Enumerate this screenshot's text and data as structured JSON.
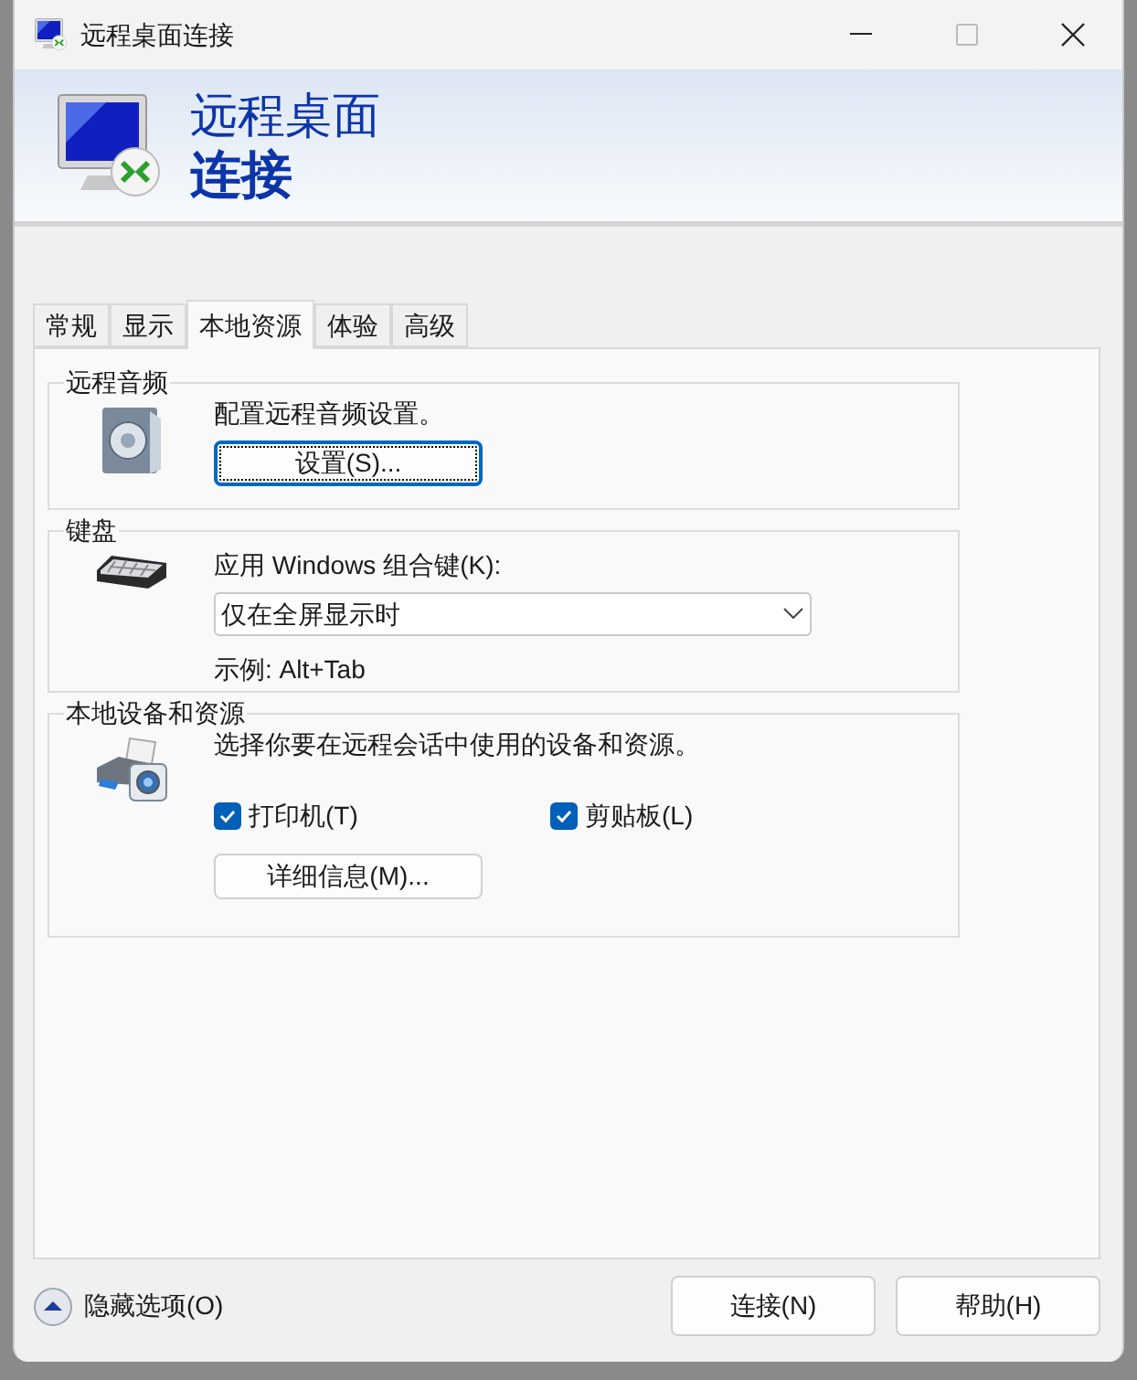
{
  "window": {
    "title": "远程桌面连接"
  },
  "banner": {
    "line1": "远程桌面",
    "line2": "连接"
  },
  "tabs": [
    {
      "label": "常规",
      "selected": false
    },
    {
      "label": "显示",
      "selected": false
    },
    {
      "label": "本地资源",
      "selected": true
    },
    {
      "label": "体验",
      "selected": false
    },
    {
      "label": "高级",
      "selected": false
    }
  ],
  "groups": [
    {
      "kind": "audio",
      "title": "远程音频",
      "description": "配置远程音频设置。",
      "button": {
        "label": "设置(S)...",
        "focused": true
      }
    },
    {
      "kind": "keyboard",
      "title": "键盘",
      "field_label": "应用 Windows 组合键(K):",
      "dropdown": {
        "value": "仅在全屏显示时"
      },
      "example": "示例: Alt+Tab"
    },
    {
      "kind": "devices",
      "title": "本地设备和资源",
      "description": "选择你要在远程会话中使用的设备和资源。",
      "checkboxes": [
        {
          "label": "打印机(T)",
          "checked": true
        },
        {
          "label": "剪贴板(L)",
          "checked": true
        }
      ],
      "button": {
        "label": "详细信息(M)...",
        "focused": false
      }
    }
  ],
  "footer": {
    "toggle": "隐藏选项(O)",
    "buttons": [
      "连接(N)",
      "帮助(H)"
    ]
  }
}
